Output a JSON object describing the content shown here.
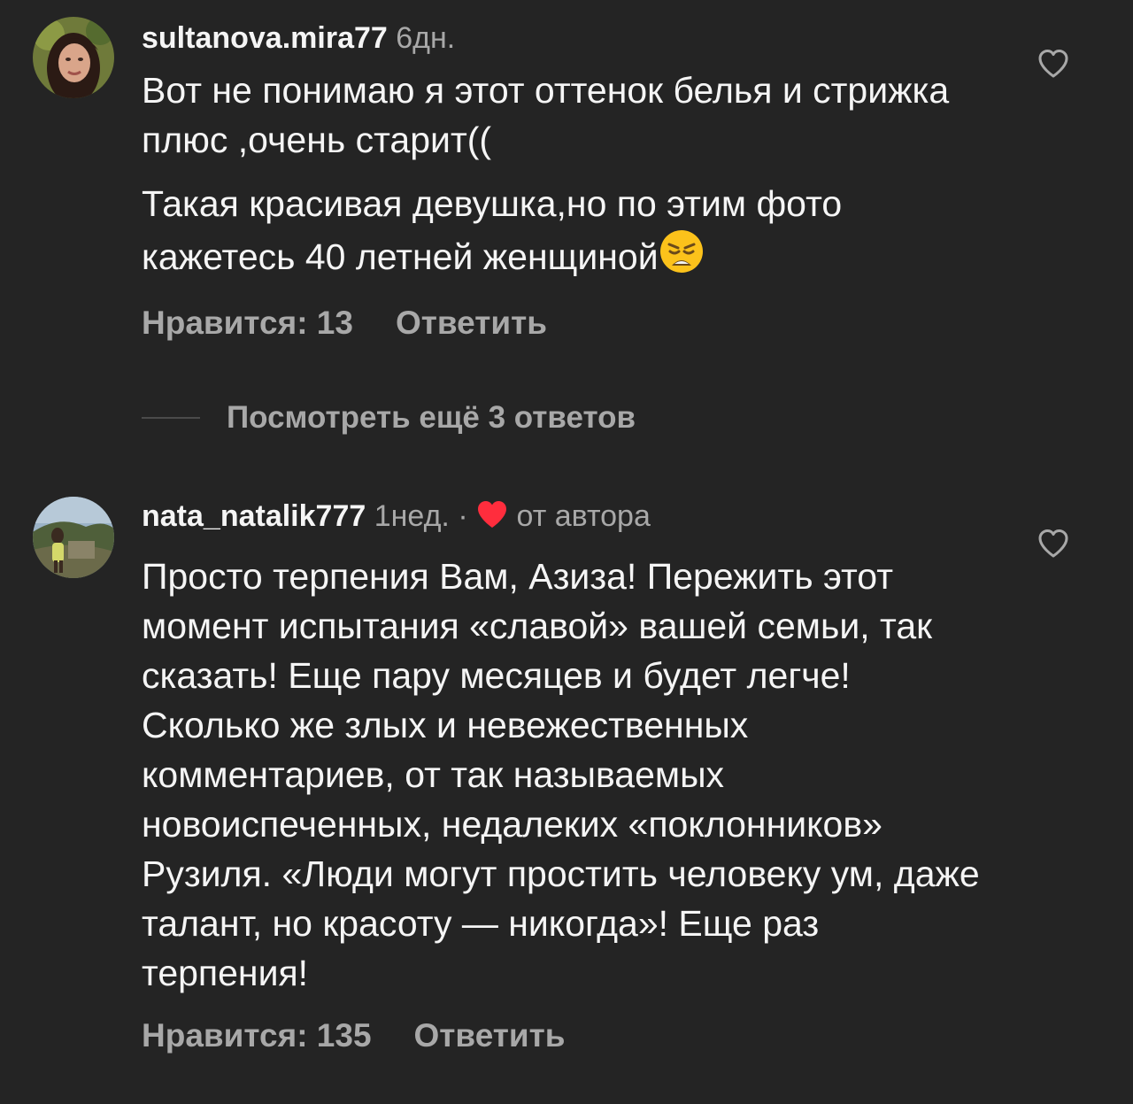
{
  "comments": [
    {
      "username": "sultanova.mira77",
      "time": "6дн.",
      "paragraphs": [
        "Вот не понимаю я этот оттенок белья и стрижка плюс ,очень старит((",
        "Такая красивая девушка,но по этим фото кажетесь 40 летней женщиной"
      ],
      "emoji": "😩",
      "likes_label": "Нравится: 13",
      "reply_label": "Ответить"
    },
    {
      "username": "nata_natalik777",
      "time": "1нед.",
      "separator": "·",
      "author_liked_label": "от автора",
      "text": "Просто терпения Вам, Азиза! Пережить этот момент испытания «славой» вашей семьи, так сказать! Еще пару месяцев и будет легче! Сколько же злых и невежественных комментариев, от так называемых новоиспеченных, недалеких «поклонников» Рузиля. «Люди могут простить человеку ум, даже талант, но красоту — никогда»! Еще раз терпения!",
      "likes_label": "Нравится: 135",
      "reply_label": "Ответить"
    }
  ],
  "view_replies_label": "Посмотреть ещё 3 ответов",
  "colors": {
    "background": "#242424",
    "primary_text": "#f5f5f5",
    "secondary_text": "#a8a8a8",
    "author_heart": "#ff2d3d"
  },
  "icons": {
    "like": "heart-outline-icon",
    "author_like": "heart-filled-icon"
  }
}
